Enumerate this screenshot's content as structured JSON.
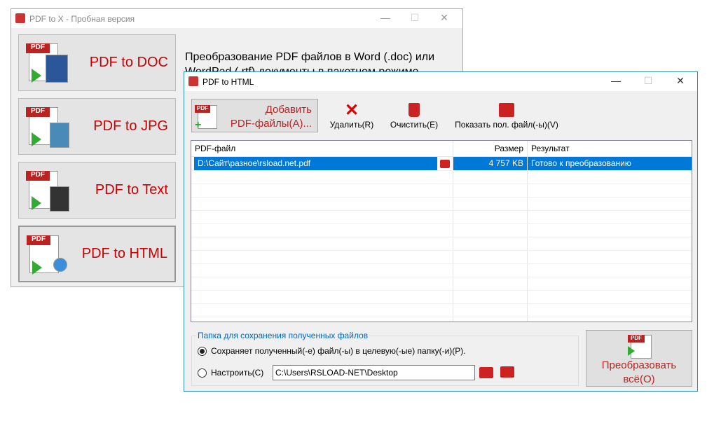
{
  "main_window": {
    "title": "PDF to X - Пробная версия",
    "description_line1": "Преобразование PDF файлов в Word (.doc) или",
    "description_line2": "WordPad (.rtf) документы в пакетном режиме",
    "buttons": [
      {
        "label": "PDF to DOC"
      },
      {
        "label": "PDF to JPG"
      },
      {
        "label": "PDF to Text"
      },
      {
        "label": "PDF to HTML"
      }
    ]
  },
  "dialog": {
    "title": "PDF to HTML",
    "toolbar": {
      "add_line1": "Добавить",
      "add_line2": "PDF-файлы(A)...",
      "delete": "Удалить(R)",
      "clear": "Очистить(E)",
      "show": "Показать пол. файл(-ы)(V)"
    },
    "table": {
      "columns": [
        "PDF-файл",
        "Размер",
        "Результат"
      ],
      "rows": [
        {
          "file": "D:\\Сайт\\разное\\rsload.net.pdf",
          "size": "4 757 KB",
          "result": "Готово к преобразованию"
        }
      ]
    },
    "output": {
      "group_label": "Папка для сохранения полученных файлов",
      "option_same": "Сохраняет полученный(-е) файл(-ы) в целевую(-ые) папку(-и)(P).",
      "option_custom": "Настроить(C)",
      "path": "C:\\Users\\RSLOAD-NET\\Desktop"
    },
    "convert_line1": "Преобразовать",
    "convert_line2": "всё(O)"
  },
  "colors": {
    "accent": "#0078d7",
    "label_red": "#c00000"
  }
}
